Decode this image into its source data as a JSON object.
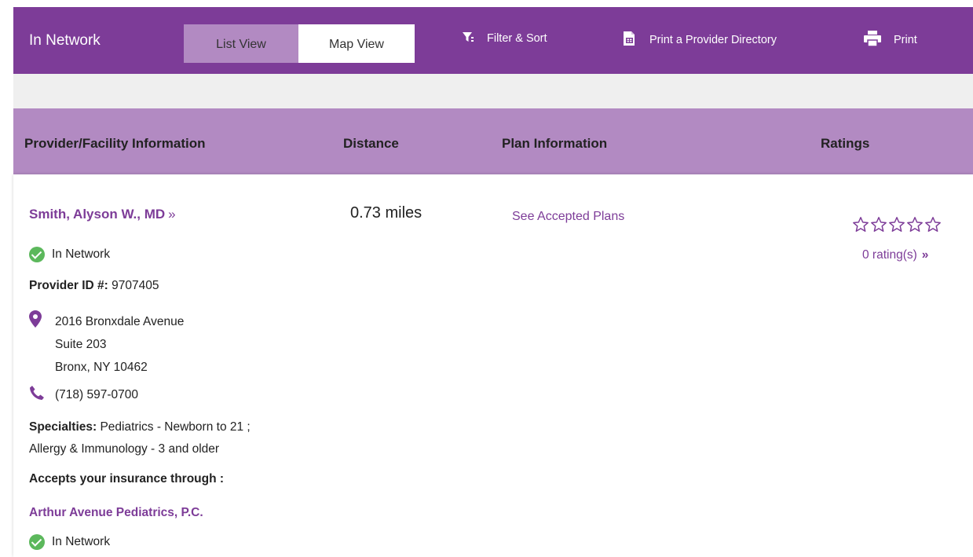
{
  "header": {
    "title": "In Network",
    "tabs": [
      {
        "label": "List View",
        "selected": true
      },
      {
        "label": "Map View",
        "selected": false
      }
    ],
    "tools": {
      "filter_label": "Filter & Sort",
      "directory_label": "Print a Provider Directory",
      "print_label": "Print"
    }
  },
  "table": {
    "columns": {
      "provider": "Provider/Facility Information",
      "distance": "Distance",
      "plan": "Plan Information",
      "ratings": "Ratings"
    }
  },
  "provider": {
    "name": "Smith, Alyson W., MD",
    "name_arrow": "»",
    "network_status": "In Network",
    "id_label": "Provider ID #:",
    "id_value": "9707405",
    "address": [
      "2016 Bronxdale Avenue",
      "Suite 203",
      "Bronx, NY 10462"
    ],
    "phone": "(718) 597-0700",
    "specialties_label": "Specialties:",
    "specialties_line1": "Pediatrics - Newborn to 21 ;",
    "specialties_line2": "Allergy & Immunology - 3 and older",
    "accepts_label": "Accepts your insurance through :",
    "group_name": "Arthur Avenue Pediatrics, P.C.",
    "group_network_status": "In Network",
    "distance": "0.73 miles",
    "plans_link": "See Accepted Plans",
    "stars_filled": 0,
    "stars_total": 5,
    "ratings_text": "0 rating(s)",
    "ratings_arrow": "»"
  },
  "colors": {
    "brand": "#7d3c98",
    "brand_light": "#b28ac2",
    "success": "#5cb85c"
  }
}
